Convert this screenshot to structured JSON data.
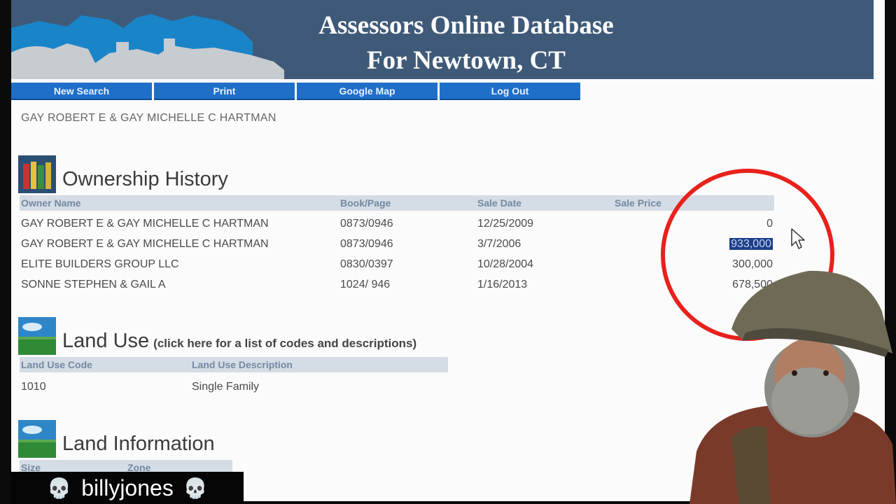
{
  "banner": {
    "title_line1": "Assessors Online Database",
    "title_line2": "For Newtown, CT"
  },
  "nav": [
    "New Search",
    "Print",
    "Google Map",
    "Log Out"
  ],
  "current_owner_partial": "GAY ROBERT E & GAY MICHELLE C HARTMAN",
  "ownership_history": {
    "title": "Ownership History",
    "columns": [
      "Owner Name",
      "Book/Page",
      "Sale Date",
      "Sale Price"
    ],
    "rows": [
      {
        "owner": "GAY ROBERT E & GAY MICHELLE C HARTMAN",
        "book_page": "0873/0946",
        "sale_date": "12/25/2009",
        "sale_price": "0"
      },
      {
        "owner": "GAY ROBERT E & GAY MICHELLE C HARTMAN",
        "book_page": "0873/0946",
        "sale_date": "3/7/2006",
        "sale_price": "933,000"
      },
      {
        "owner": "ELITE BUILDERS GROUP LLC",
        "book_page": "0830/0397",
        "sale_date": "10/28/2004",
        "sale_price": "300,000"
      },
      {
        "owner": "SONNE STEPHEN & GAIL A",
        "book_page": "1024/ 946",
        "sale_date": "1/16/2013",
        "sale_price": "678,500"
      }
    ]
  },
  "land_use": {
    "title": "Land Use",
    "link": "(click here for a list of codes and descriptions)",
    "columns": [
      "Land Use Code",
      "Land Use Description"
    ],
    "rows": [
      {
        "code": "1010",
        "description": "Single Family"
      }
    ]
  },
  "land_information": {
    "title": "Land Information",
    "columns": [
      "Size",
      "Zone"
    ]
  },
  "overlay": {
    "streamer_name": "billyjones",
    "skull_glyph": "💀",
    "highlight_color": "#e8211c"
  },
  "colors": {
    "banner_bg": "#3f5a78",
    "nav_bg": "#1f6fc9",
    "table_header_bg": "#d4dce5",
    "selection_bg": "#1c3f8a"
  }
}
